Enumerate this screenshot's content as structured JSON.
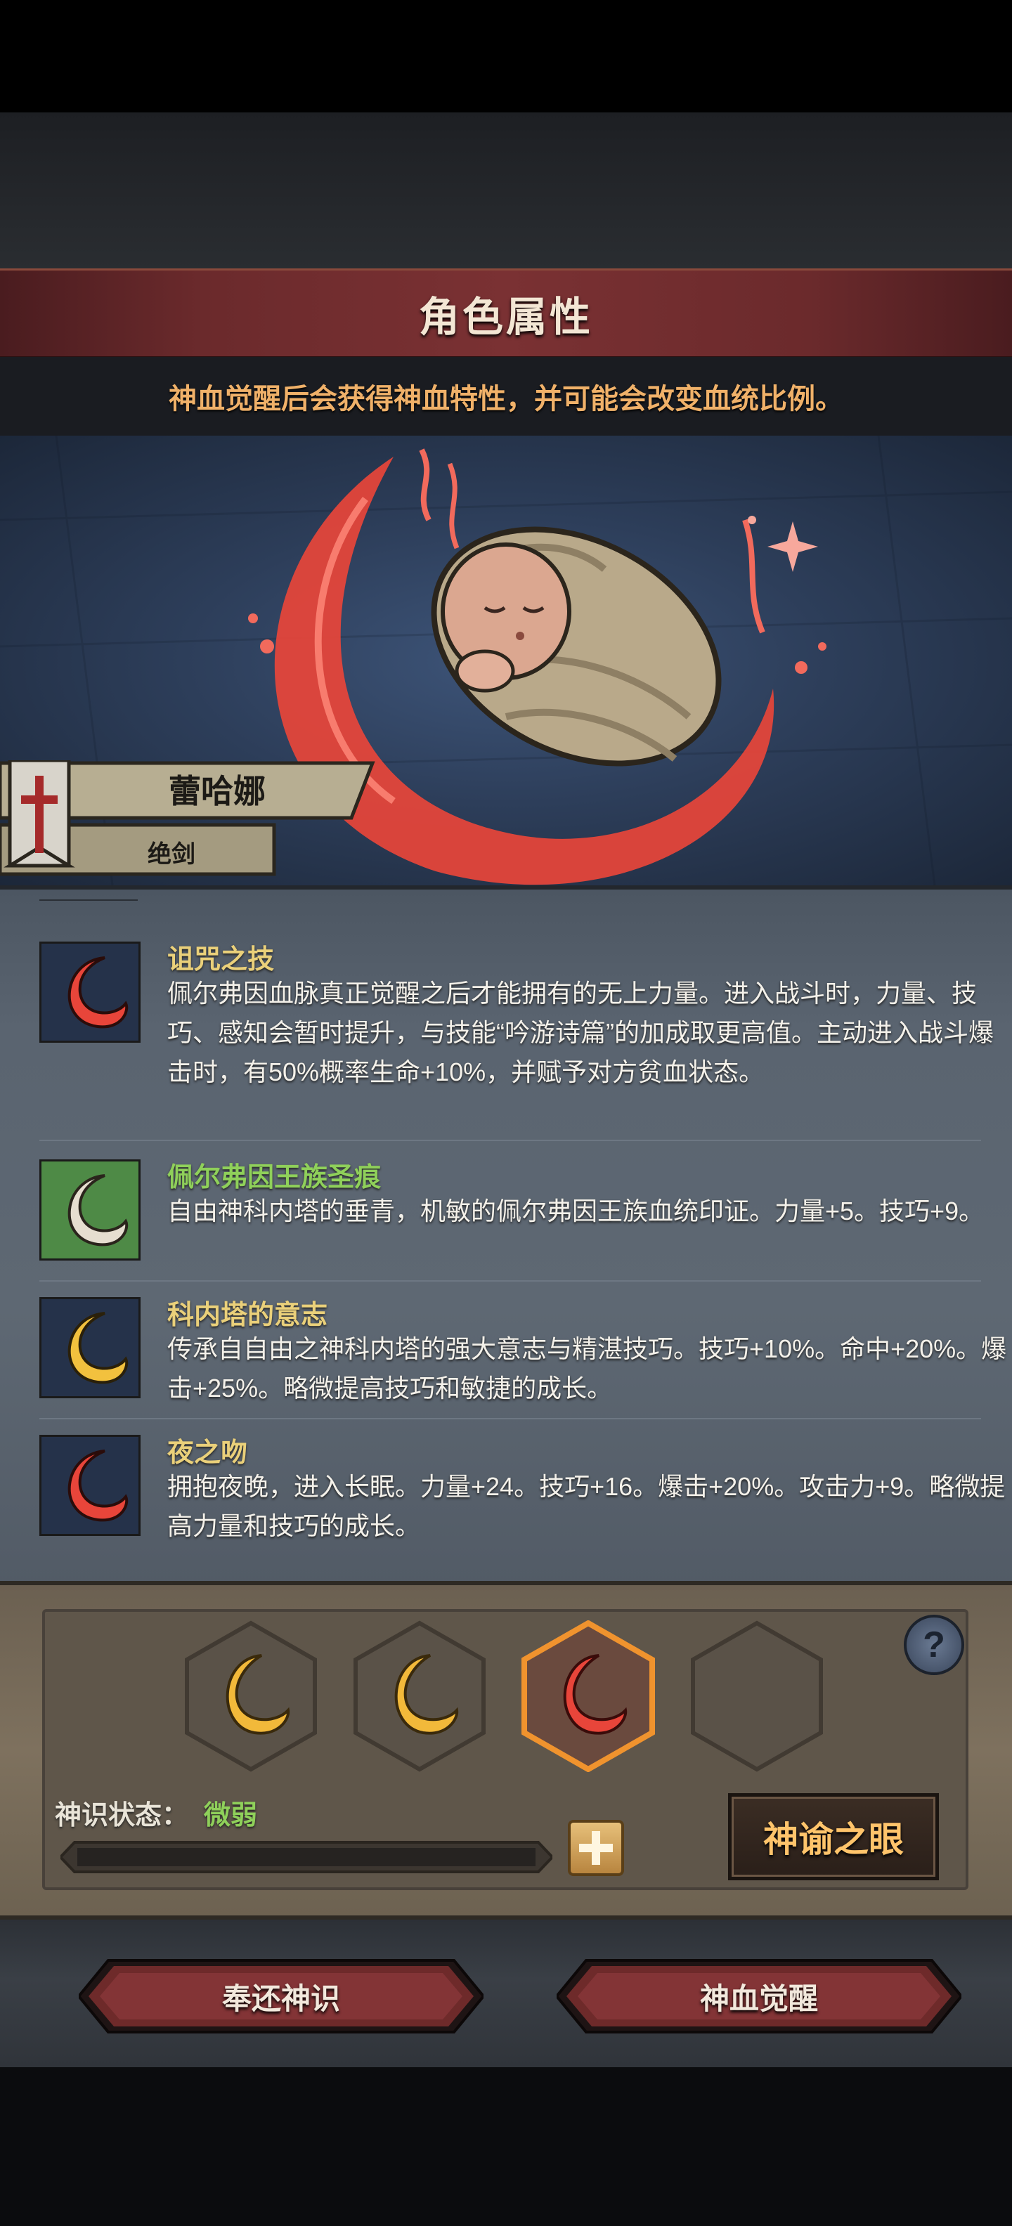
{
  "header": {
    "title": "角色属性"
  },
  "notice": "神血觉醒后会获得神血特性，并可能会改变血统比例。",
  "character": {
    "name": "蕾哈娜",
    "title": "绝剑"
  },
  "skills": [
    {
      "name": "诅咒之技",
      "name_color": "yellow",
      "icon": "red-crescent-icon",
      "desc": "佩尔弗因血脉真正觉醒之后才能拥有的无上力量。进入战斗时，力量、技巧、感知会暂时提升，与技能“吟游诗篇”的加成取更高值。主动进入战斗爆击时，有50%概率生命+10%，并赋予对方贫血状态。"
    },
    {
      "name": "佩尔弗因王族圣痕",
      "name_color": "green",
      "icon": "white-crescent-icon",
      "desc": "自由神科内塔的垂青，机敏的佩尔弗因王族血统印证。力量+5。技巧+9。"
    },
    {
      "name": "科内塔的意志",
      "name_color": "yellow",
      "icon": "gold-crescent-icon",
      "desc": "传承自自由之神科内塔的强大意志与精湛技巧。技巧+10%。命中+20%。爆击+25%。略微提高技巧和敏捷的成长。"
    },
    {
      "name": "夜之吻",
      "name_color": "yellow",
      "icon": "red-crescent-icon",
      "desc": "拥抱夜晚，进入长眠。力量+24。技巧+16。爆击+20%。攻击力+9。略微提高力量和技巧的成长。"
    }
  ],
  "slots": [
    {
      "state": "filled",
      "color": "gold",
      "icon": "gold-crescent-icon"
    },
    {
      "state": "filled",
      "color": "gold",
      "icon": "gold-crescent-icon"
    },
    {
      "state": "selected",
      "color": "red",
      "icon": "red-crescent-icon"
    },
    {
      "state": "empty"
    }
  ],
  "help_label": "?",
  "sense": {
    "label": "神识状态：",
    "value": "微弱",
    "progress": 0
  },
  "oracle_button": "神谕之眼",
  "actions": {
    "return_label": "奉还神识",
    "awaken_label": "神血觉醒"
  },
  "colors": {
    "accent_gold": "#f0b169",
    "skill_name_yellow": "#ead07a",
    "skill_name_green": "#8fd05a",
    "crescent_red": "#e8453a"
  }
}
